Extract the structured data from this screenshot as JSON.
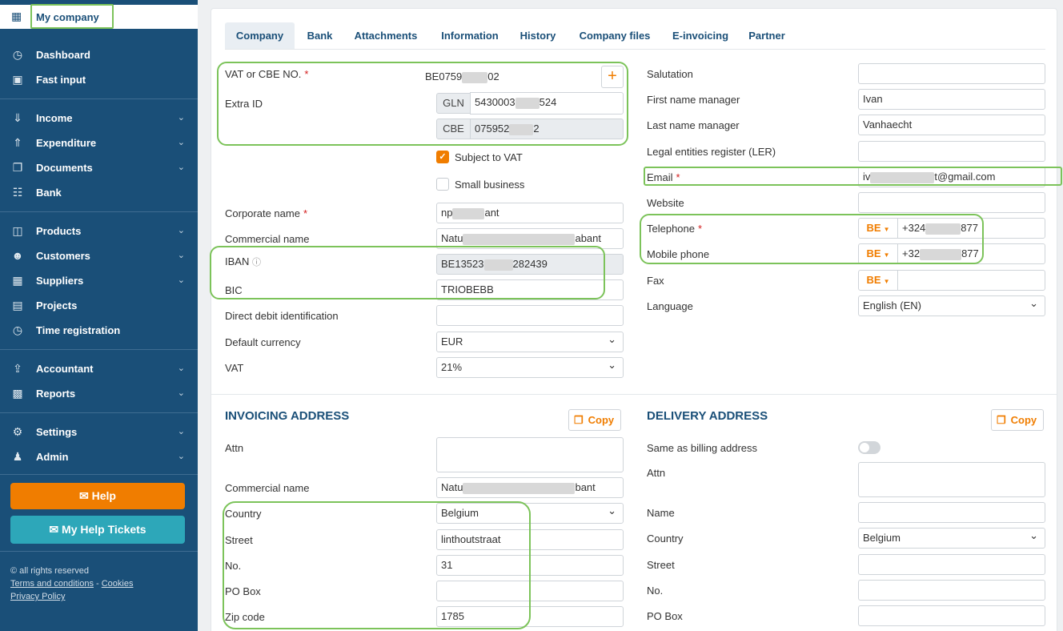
{
  "sidebar": {
    "company": "My company",
    "items": [
      {
        "label": "Dashboard"
      },
      {
        "label": "Fast input"
      },
      {
        "label": "Income"
      },
      {
        "label": "Expenditure"
      },
      {
        "label": "Documents"
      },
      {
        "label": "Bank"
      },
      {
        "label": "Products"
      },
      {
        "label": "Customers"
      },
      {
        "label": "Suppliers"
      },
      {
        "label": "Projects"
      },
      {
        "label": "Time registration"
      },
      {
        "label": "Accountant"
      },
      {
        "label": "Reports"
      },
      {
        "label": "Settings"
      },
      {
        "label": "Admin"
      }
    ],
    "help": "Help",
    "tickets": "My Help Tickets",
    "legal": {
      "rights": "© all rights reserved",
      "terms": "Terms and conditions",
      "dash": " - ",
      "cookies": "Cookies",
      "privacy": "Privacy Policy"
    }
  },
  "tabs": [
    "Company",
    "Bank",
    "Attachments",
    "Information",
    "History",
    "Company files",
    "E-invoicing",
    "Partner"
  ],
  "company": {
    "vat_label": "VAT or CBE NO.",
    "vat_pre": "BE0759",
    "vat_post": "02",
    "extra_id_label": "Extra ID",
    "gln_addon": "GLN",
    "gln_pre": "5430003",
    "gln_post": "524",
    "cbe_addon": "CBE",
    "cbe_pre": "075952",
    "cbe_post": "2",
    "subject_vat": "Subject to VAT",
    "small_business": "Small business",
    "corporate_label": "Corporate name",
    "corporate_pre": "np",
    "corporate_post": "ant",
    "commercial_label": "Commercial name",
    "commercial_pre": "Natu",
    "commercial_post": "abant",
    "iban_label": "IBAN",
    "iban_pre": "BE13523",
    "iban_post": "282439",
    "bic_label": "BIC",
    "bic_value": "TRIOBEBB",
    "direct_debit_label": "Direct debit identification",
    "currency_label": "Default currency",
    "currency_value": "EUR",
    "vat_rate_label": "VAT",
    "vat_rate_value": "21%"
  },
  "contact": {
    "salutation_label": "Salutation",
    "first_label": "First name manager",
    "first_value": "Ivan",
    "last_label": "Last name manager",
    "last_value": "Vanhaecht",
    "ler_label": "Legal entities register (LER)",
    "email_label": "Email",
    "email_pre": "iv",
    "email_post": "t@gmail.com",
    "website_label": "Website",
    "tel_label": "Telephone",
    "tel_cc": "BE",
    "tel_pre": "+324",
    "tel_post": "877",
    "mobile_label": "Mobile phone",
    "mobile_cc": "BE",
    "mobile_pre": "+32",
    "mobile_post": "877",
    "fax_label": "Fax",
    "fax_cc": "BE",
    "language_label": "Language",
    "language_value": "English (EN)"
  },
  "invoicing": {
    "title": "INVOICING ADDRESS",
    "copy": "Copy",
    "attn_label": "Attn",
    "commercial_label": "Commercial name",
    "commercial_pre": "Natu",
    "commercial_post": "bant",
    "country_label": "Country",
    "country_value": "Belgium",
    "street_label": "Street",
    "street_value": "linthoutstraat",
    "no_label": "No.",
    "no_value": "31",
    "pobox_label": "PO Box",
    "zip_label": "Zip code",
    "zip_value": "1785"
  },
  "delivery": {
    "title": "DELIVERY ADDRESS",
    "copy": "Copy",
    "same_label": "Same as billing address",
    "attn_label": "Attn",
    "name_label": "Name",
    "country_label": "Country",
    "country_value": "Belgium",
    "street_label": "Street",
    "no_label": "No.",
    "pobox_label": "PO Box"
  },
  "colors": {
    "sidebar": "#1a4f78",
    "accent": "#f07d00",
    "teal": "#2da7b9",
    "highlight": "#7cc35a",
    "required": "#d31b1b"
  }
}
